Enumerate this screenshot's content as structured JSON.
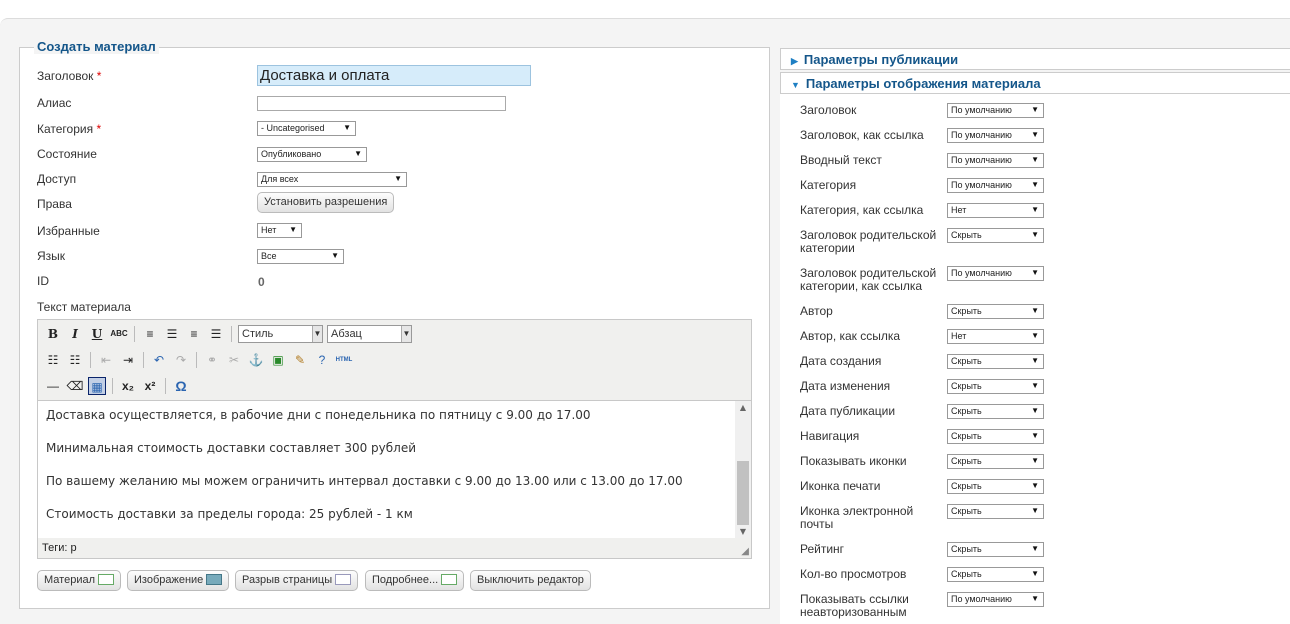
{
  "form": {
    "legend": "Создать материал",
    "labels": {
      "title": "Заголовок",
      "alias": "Алиас",
      "category": "Категория",
      "state": "Состояние",
      "access": "Доступ",
      "permissions": "Права",
      "featured": "Избранные",
      "language": "Язык",
      "id": "ID",
      "article_text": "Текст материала"
    },
    "required_mark": "*",
    "title_value": "Доставка и оплата",
    "alias_value": "",
    "category_value": "- Uncategorised",
    "state_value": "Опубликовано",
    "access_value": "Для всех",
    "permissions_button": "Установить разрешения",
    "featured_value": "Нет",
    "language_value": "Все",
    "id_value": "0"
  },
  "editor": {
    "style_select": "Стиль",
    "format_select": "Абзац",
    "paragraphs": [
      "Доставка осуществляется, в рабочие дни с понедельника по пятницу с 9.00 до 17.00",
      "Минимальная стоимость доставки составляет 300 рублей",
      "По вашему желанию мы можем ограничить интервал доставки с 9.00 до 13.00 или с 13.00 до 17.00",
      "Стоимость доставки за пределы города: 25 рублей - 1 км"
    ],
    "status_path": "Теги: p",
    "icons": {
      "bold": "B",
      "italic": "I",
      "underline": "U",
      "strike": "ABC",
      "subscript": "x₂",
      "superscript": "x²",
      "omega": "Ω",
      "html": "HTML"
    }
  },
  "buttons": {
    "article": "Материал",
    "image": "Изображение",
    "pagebreak": "Разрыв страницы",
    "readmore": "Подробнее...",
    "toggle_editor": "Выключить редактор"
  },
  "right_panel": {
    "publishing_header": "Параметры публикации",
    "display_header": "Параметры отображения материала",
    "options": [
      {
        "label": "Заголовок",
        "value": "По умолчанию"
      },
      {
        "label": "Заголовок, как ссылка",
        "value": "По умолчанию"
      },
      {
        "label": "Вводный текст",
        "value": "По умолчанию"
      },
      {
        "label": "Категория",
        "value": "По умолчанию"
      },
      {
        "label": "Категория, как ссылка",
        "value": "Нет"
      },
      {
        "label": "Заголовок родительской категории",
        "value": "Скрыть"
      },
      {
        "label": "Заголовок родительской категории, как ссылка",
        "value": "По умолчанию"
      },
      {
        "label": "Автор",
        "value": "Скрыть"
      },
      {
        "label": "Автор, как ссылка",
        "value": "Нет"
      },
      {
        "label": "Дата создания",
        "value": "Скрыть"
      },
      {
        "label": "Дата изменения",
        "value": "Скрыть"
      },
      {
        "label": "Дата публикации",
        "value": "Скрыть"
      },
      {
        "label": "Навигация",
        "value": "Скрыть"
      },
      {
        "label": "Показывать иконки",
        "value": "Скрыть"
      },
      {
        "label": "Иконка печати",
        "value": "Скрыть"
      },
      {
        "label": "Иконка электронной почты",
        "value": "Скрыть"
      },
      {
        "label": "Рейтинг",
        "value": "Скрыть"
      },
      {
        "label": "Кол-во просмотров",
        "value": "Скрыть"
      },
      {
        "label": "Показывать ссылки неавторизованным",
        "value": "По умолчанию"
      }
    ]
  },
  "colors": {
    "accent": "#14568a",
    "title_input_bg": "#d6ecfa"
  }
}
